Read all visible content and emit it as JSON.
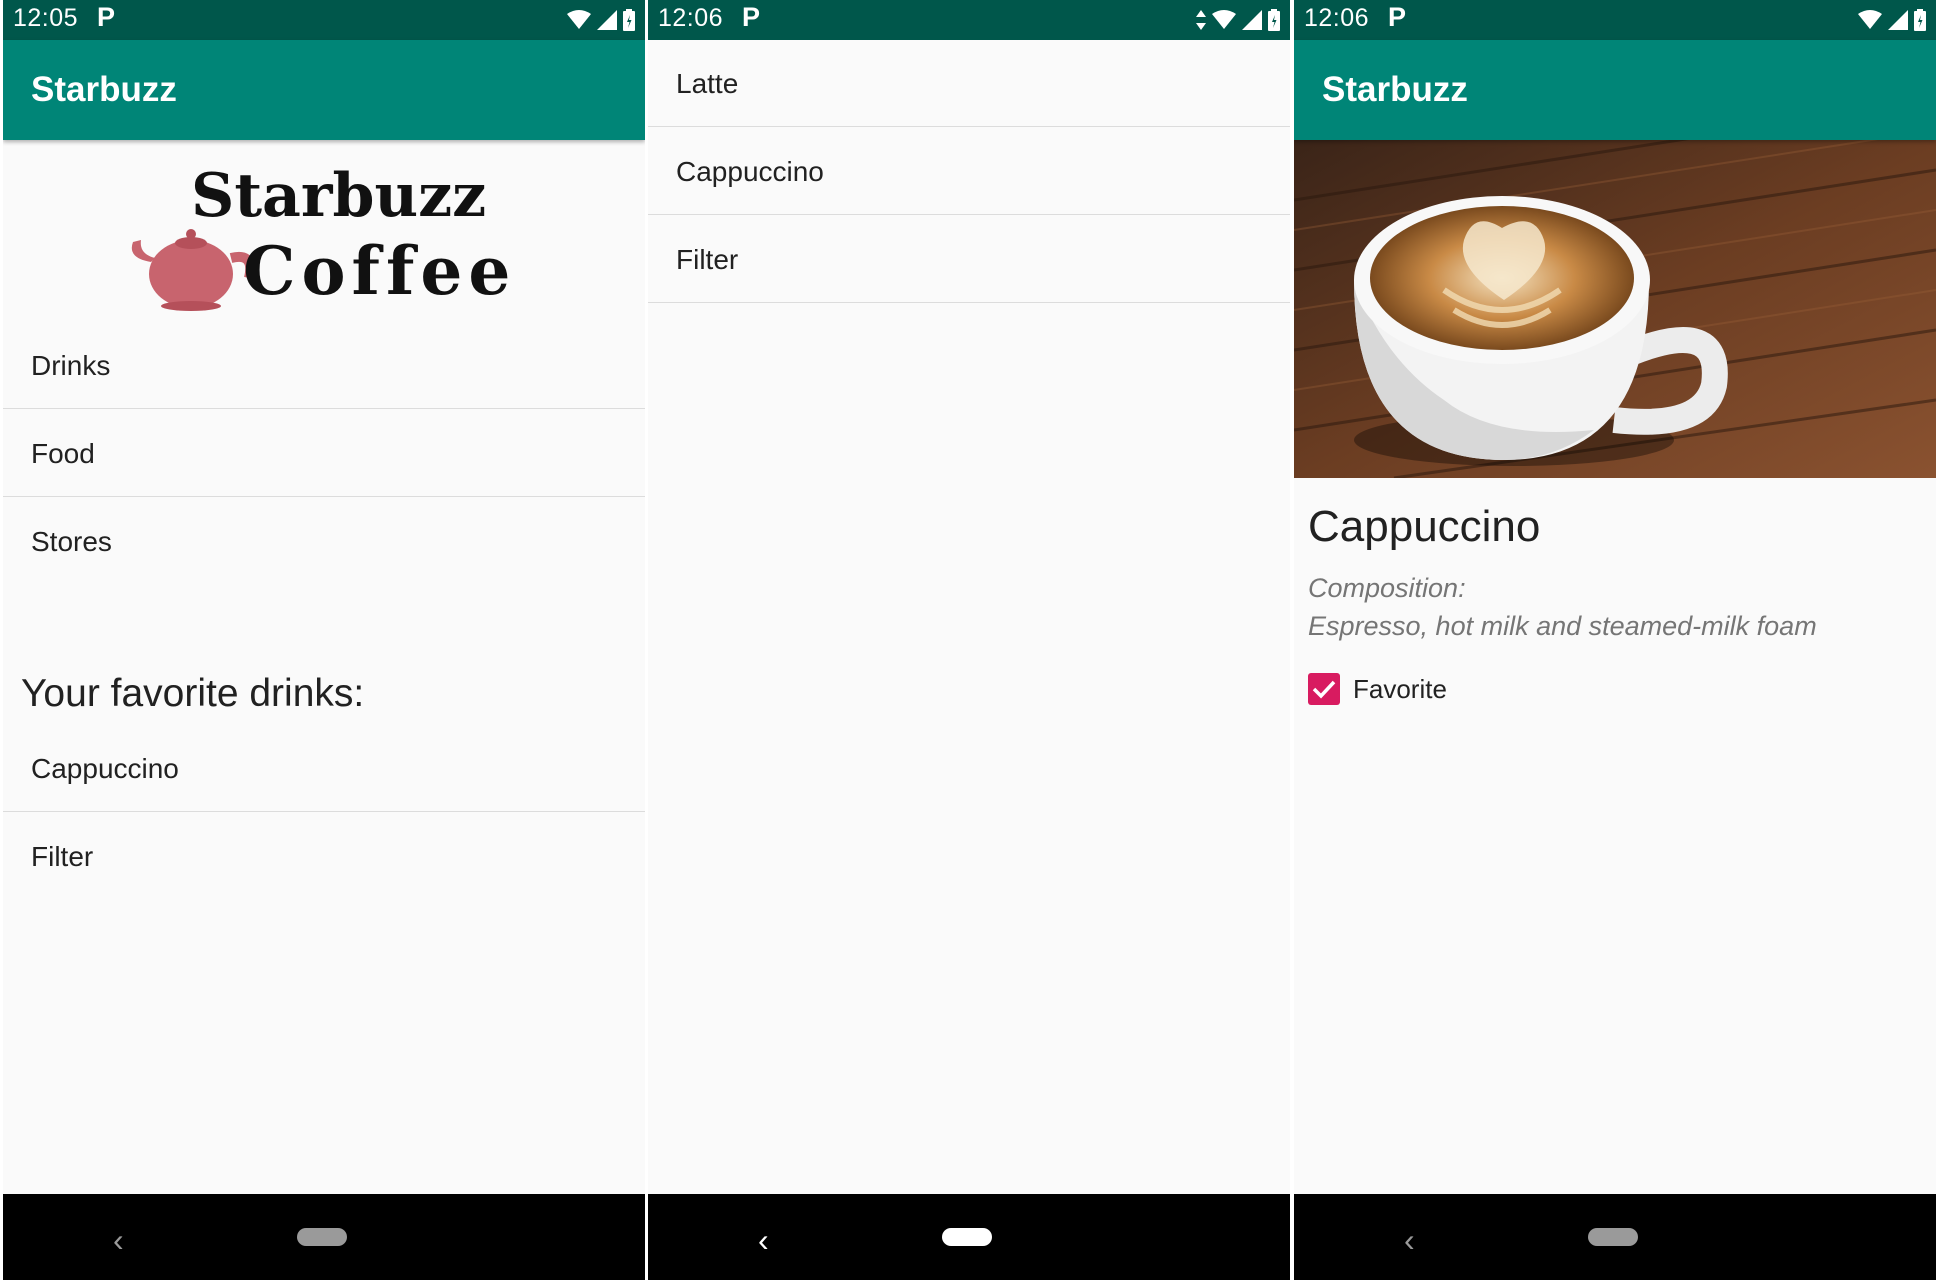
{
  "screens": [
    {
      "status_time": "12:05",
      "status_p": "P",
      "app_title": "Starbuzz",
      "logo_text_line1": "Starbuzz",
      "logo_text_line2": "Coffee",
      "menu_items": [
        "Drinks",
        "Food",
        "Stores"
      ],
      "favorites_heading": "Your favorite drinks:",
      "favorites": [
        "Cappuccino",
        "Filter"
      ]
    },
    {
      "status_time": "12:06",
      "status_p": "P",
      "drinks": [
        "Latte",
        "Cappuccino",
        "Filter"
      ]
    },
    {
      "status_time": "12:06",
      "status_p": "P",
      "app_title": "Starbuzz",
      "drink_name": "Cappuccino",
      "composition_label": "Composition:",
      "composition": "Espresso, hot milk and steamed-milk foam",
      "favorite_label": "Favorite",
      "favorite_checked": true
    }
  ],
  "icons": {
    "status": [
      "wifi-icon",
      "signal-icon",
      "battery-icon",
      "data-arrows-icon"
    ],
    "nav": [
      "back-icon",
      "home-pill-icon"
    ]
  },
  "colors": {
    "status_bar": "#00574b",
    "app_bar": "#008577",
    "accent": "#d81b60",
    "background": "#fafafa",
    "nav_bar": "#000000"
  }
}
